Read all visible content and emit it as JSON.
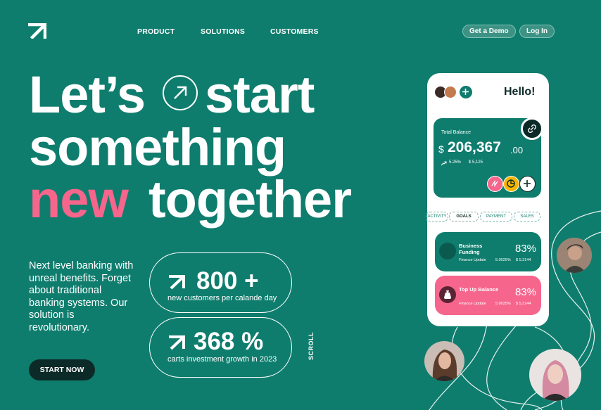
{
  "header": {
    "nav": [
      "PRODUCT",
      "SOLUTIONS",
      "CUSTOMERS"
    ],
    "demo_label": "Get a Demo",
    "login_label": "Log In"
  },
  "hero": {
    "line1_a": "Let’s",
    "line1_b": "start",
    "line2": "something",
    "line3_accent": "new",
    "line3_rest": "together",
    "accent_color": "#f6658c",
    "description": "Next level banking with unreal benefits. Forget about traditional banking systems. Our solution is revolutionary.",
    "cta_label": "START NOW",
    "scroll_label": "SCROLL"
  },
  "stats": [
    {
      "value": "800 +",
      "label": "new customers per calande day"
    },
    {
      "value": "368 %",
      "label": "carts investment growth in 2023"
    }
  ],
  "phone": {
    "greeting": "Hello!",
    "balance_label": "Total Balance",
    "currency": "$",
    "balance_main": "206,367",
    "balance_cents": ".00",
    "change_pct": "5.25%",
    "change_amount": "$ 5,125",
    "tabs": [
      "ACTIVITY",
      "GOALS",
      "PAYMENT",
      "SALES"
    ],
    "active_tab": "GOALS",
    "cards": [
      {
        "title": "Business Funding",
        "percent": "83%",
        "sub_label": "Finance Update",
        "sub_value": "5.0025%",
        "sub_amount": "$ 5,3144",
        "color": "#0f7d6e"
      },
      {
        "title": "Top Up Balance",
        "percent": "83%",
        "sub_label": "Finance Update",
        "sub_value": "5.0025%",
        "sub_amount": "$ 5,3144",
        "color": "#f6658c"
      }
    ]
  },
  "colors": {
    "background": "#0f7d6e",
    "dark": "#0c2a27",
    "pink": "#f6658c",
    "yellow": "#f7b500"
  }
}
